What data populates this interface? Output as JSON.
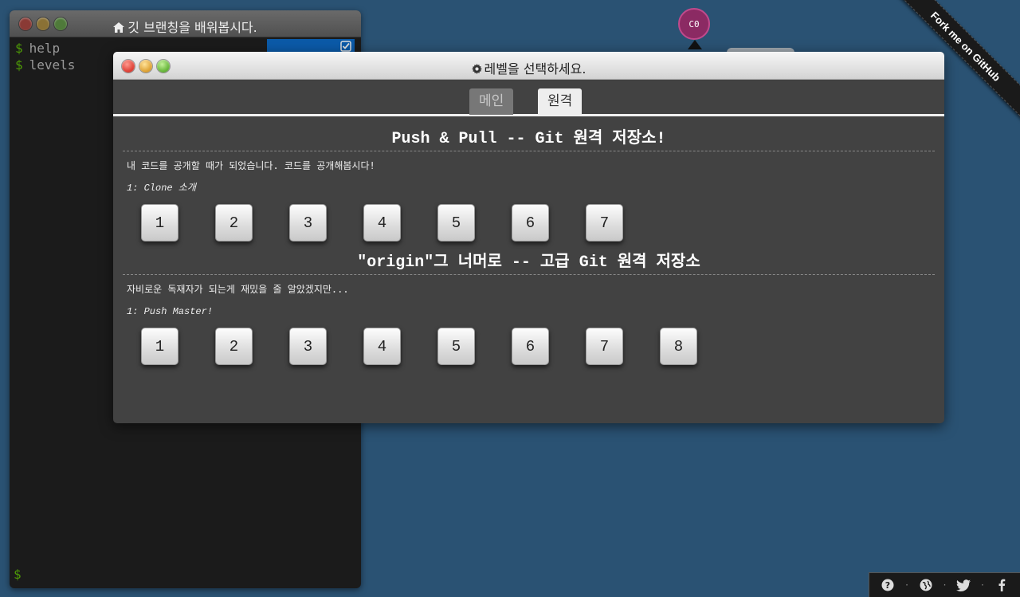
{
  "terminal": {
    "title": "깃 브랜칭을 배워봅시다.",
    "lines": [
      {
        "prompt": "$",
        "cmd": "help"
      },
      {
        "prompt": "$",
        "cmd": "levels"
      }
    ],
    "prompt": "$"
  },
  "graph": {
    "commit_label": "C0",
    "node_color": "#8b2a63"
  },
  "ribbon": {
    "text": "Fork me on GitHub"
  },
  "modal": {
    "title": "레벨을 선택하세요.",
    "tabs": [
      {
        "label": "메인",
        "active": false
      },
      {
        "label": "원격",
        "active": true
      }
    ],
    "sequences": [
      {
        "title": "Push & Pull -- Git 원격 저장소!",
        "about": "내 코드를 공개할 때가 되었습니다. 코드를 공개해봅시다!",
        "subtitle": "1: Clone 소개",
        "levels": [
          "1",
          "2",
          "3",
          "4",
          "5",
          "6",
          "7"
        ]
      },
      {
        "title": "\"origin\"그 너머로 -- 고급 Git 원격 저장소",
        "about": "자비로운 독재자가 되는게 재밌을 줄 알았겠지만...",
        "subtitle": "1: Push Master!",
        "levels": [
          "1",
          "2",
          "3",
          "4",
          "5",
          "6",
          "7",
          "8"
        ]
      }
    ]
  },
  "iconbar": {
    "icons": [
      "help-icon",
      "globe-icon",
      "twitter-icon",
      "facebook-icon"
    ],
    "separator": "·"
  },
  "colors": {
    "background": "#2a5273",
    "modal": "#424242",
    "terminal": "#1b1b1b",
    "prompt": "#4e9a06"
  }
}
